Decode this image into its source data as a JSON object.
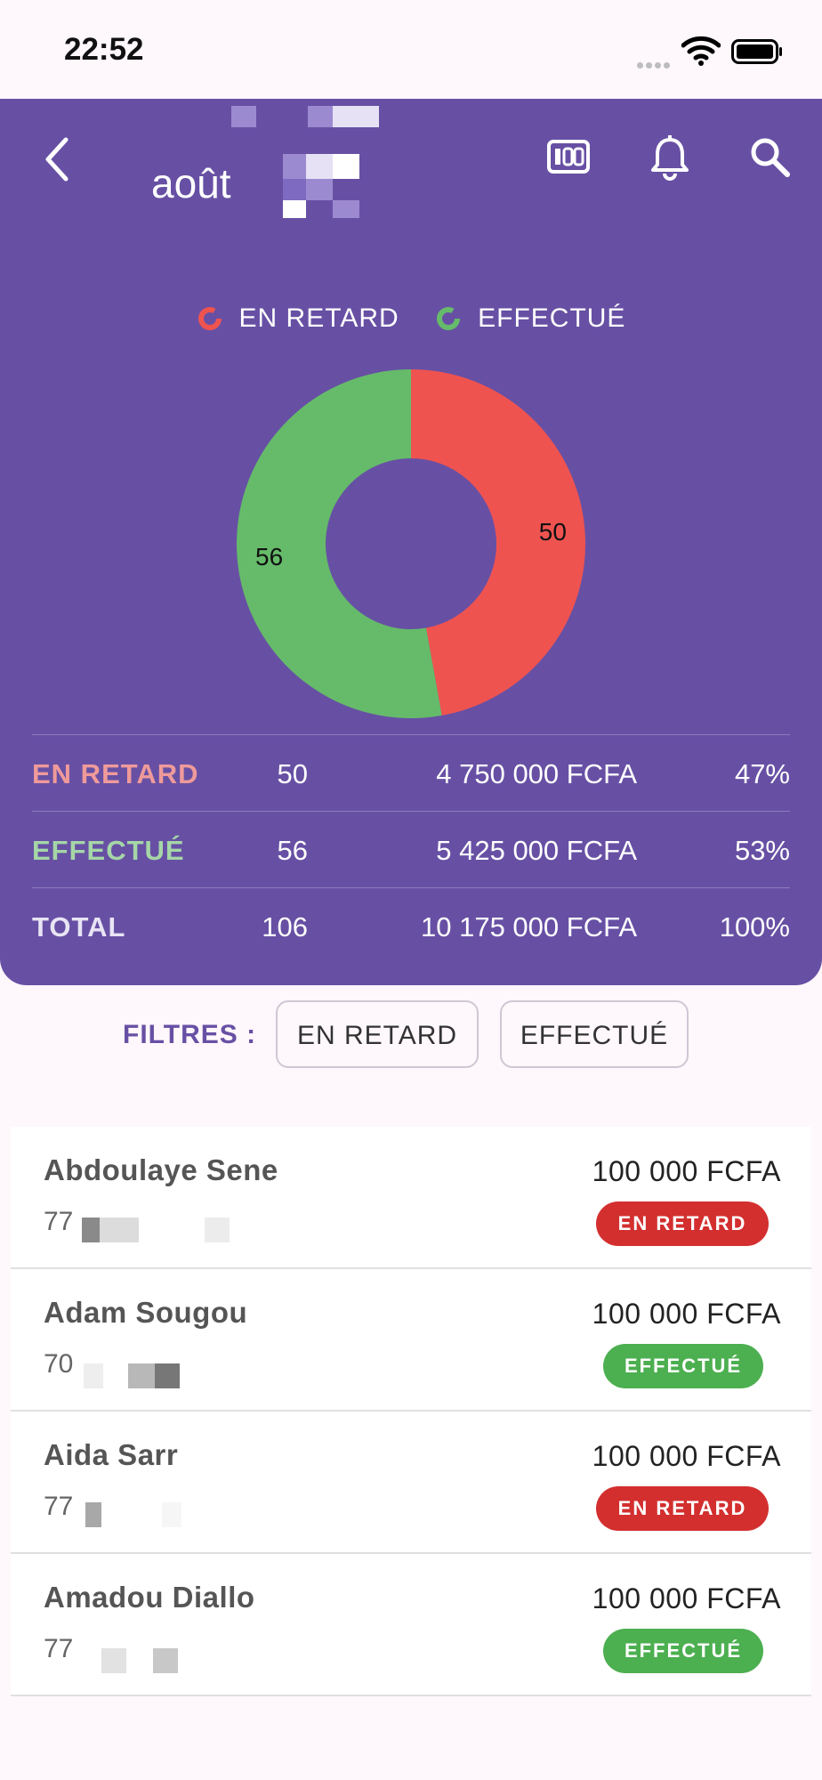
{
  "status_bar": {
    "time": "22:52"
  },
  "header": {
    "month": "août"
  },
  "legend": [
    {
      "label": "EN RETARD",
      "color": "#EF5350"
    },
    {
      "label": "EFFECTUÉ",
      "color": "#66BB6A"
    }
  ],
  "chart_data": {
    "type": "pie",
    "categories": [
      "EN RETARD",
      "EFFECTUÉ"
    ],
    "values": [
      50,
      56
    ],
    "colors": [
      "#EF5350",
      "#66BB6A"
    ],
    "labels": [
      "50",
      "56"
    ]
  },
  "summary": [
    {
      "label": "EN RETARD",
      "count": "50",
      "amount": "4 750 000 FCFA",
      "percent": "47%",
      "color": "#EF9A9A"
    },
    {
      "label": "EFFECTUÉ",
      "count": "56",
      "amount": "5 425 000 FCFA",
      "percent": "53%",
      "color": "#A5D6A7"
    },
    {
      "label": "TOTAL",
      "count": "106",
      "amount": "10 175 000 FCFA",
      "percent": "100%",
      "color": "#E8E4F4"
    }
  ],
  "filters": {
    "label": "FILTRES :",
    "chip_retard": "EN RETARD",
    "chip_effectue": "EFFECTUÉ"
  },
  "items": [
    {
      "name": "Abdoulaye Sene",
      "phone_prefix": "77",
      "amount": "100 000 FCFA",
      "status": "EN RETARD"
    },
    {
      "name": "Adam Sougou",
      "phone_prefix": "70",
      "amount": "100 000 FCFA",
      "status": "EFFECTUÉ"
    },
    {
      "name": "Aida Sarr",
      "phone_prefix": "77",
      "amount": "100 000 FCFA",
      "status": "EN RETARD"
    },
    {
      "name": "Amadou Diallo",
      "phone_prefix": "77",
      "amount": "100 000 FCFA",
      "status": "EFFECTUÉ"
    }
  ]
}
